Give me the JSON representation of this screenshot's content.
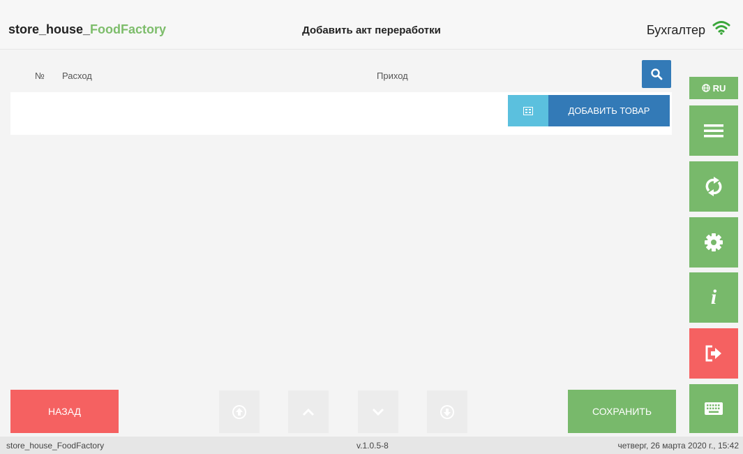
{
  "header": {
    "brand_prefix": "store_house_",
    "brand_suffix": "FoodFactory",
    "page_title": "Добавить акт переработки",
    "user_role": "Бухгалтер"
  },
  "table": {
    "columns": [
      "№",
      "Расход",
      "Приход"
    ]
  },
  "actions": {
    "add_item_label": "ДОБАВИТЬ ТОВАР"
  },
  "sidebar": {
    "language": "RU",
    "buttons": [
      "menu-icon",
      "sync-icon",
      "settings-icon",
      "info-icon",
      "logout-icon",
      "keyboard-icon"
    ]
  },
  "bottom": {
    "back_label": "НАЗАД",
    "save_label": "СОХРАНИТЬ"
  },
  "status": {
    "app_name": "store_house_FoodFactory",
    "version": "v.1.0.5-8",
    "datetime": "четверг, 26 марта 2020 г., 15:42"
  },
  "colors": {
    "brand_green": "#7dbd6b",
    "sidebar_green": "#78b96b",
    "danger_red": "#f56161",
    "primary_blue": "#337ab7",
    "info_cyan": "#5bc0de"
  }
}
